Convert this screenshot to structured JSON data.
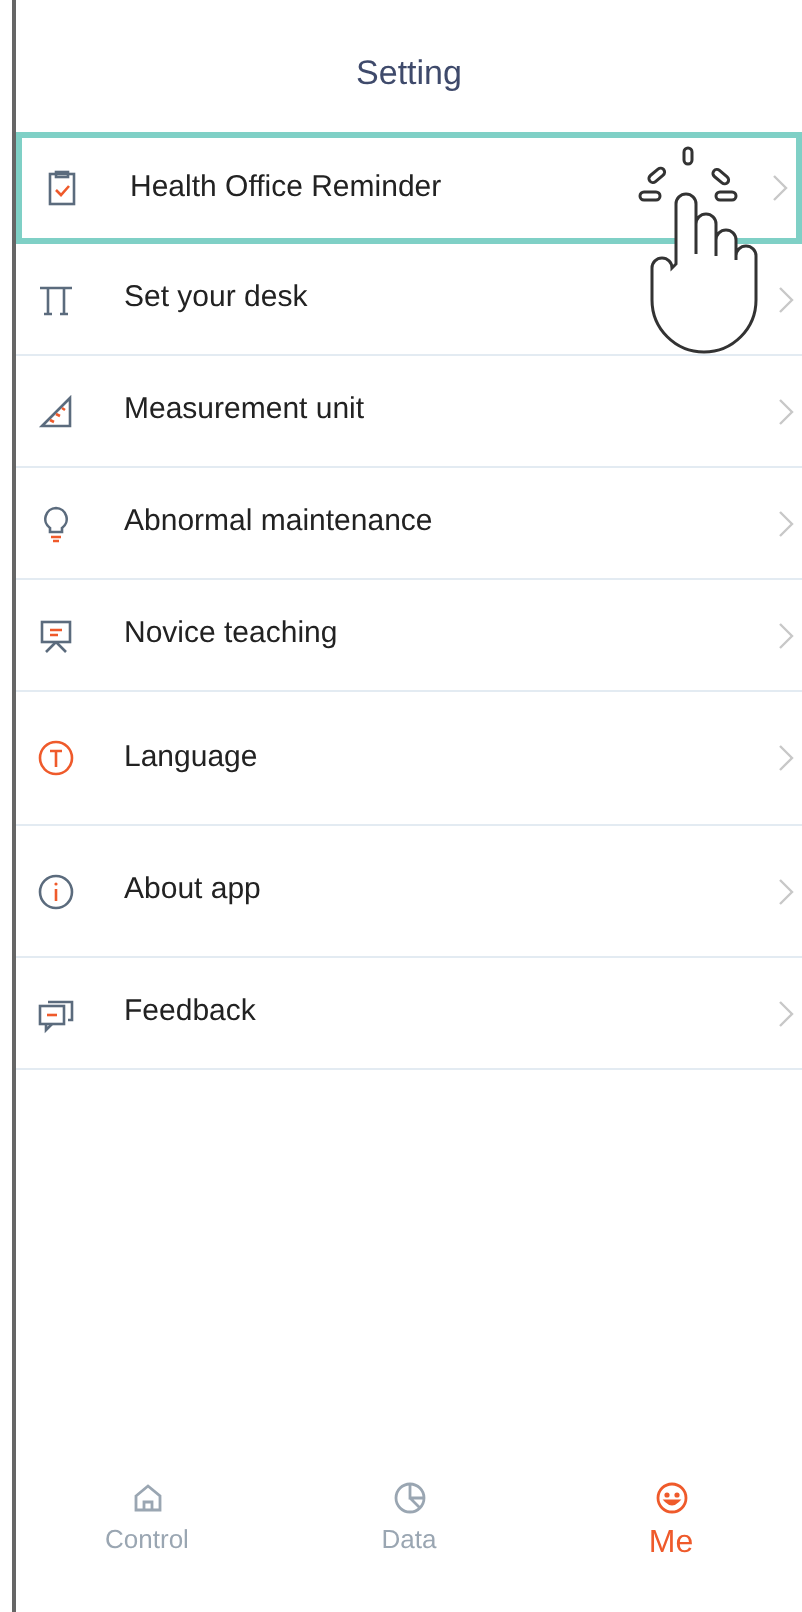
{
  "header": {
    "title": "Setting"
  },
  "menu": [
    {
      "kind": "clipboard",
      "label": "Health Office Reminder",
      "selected": true
    },
    {
      "kind": "desk",
      "label": "Set your desk",
      "selected": false
    },
    {
      "kind": "ruler",
      "label": "Measurement unit",
      "selected": false
    },
    {
      "kind": "bulb",
      "label": "Abnormal maintenance",
      "selected": false
    },
    {
      "kind": "easel",
      "label": "Novice teaching",
      "selected": false
    },
    {
      "kind": "language",
      "label": "Language",
      "selected": false
    },
    {
      "kind": "info",
      "label": "About app",
      "selected": false
    },
    {
      "kind": "chat",
      "label": "Feedback",
      "selected": false
    }
  ],
  "tabs": [
    {
      "kind": "home",
      "label": "Control",
      "selected": false
    },
    {
      "kind": "pie",
      "label": "Data",
      "selected": false
    },
    {
      "kind": "smile",
      "label": "Me",
      "selected": true
    }
  ]
}
